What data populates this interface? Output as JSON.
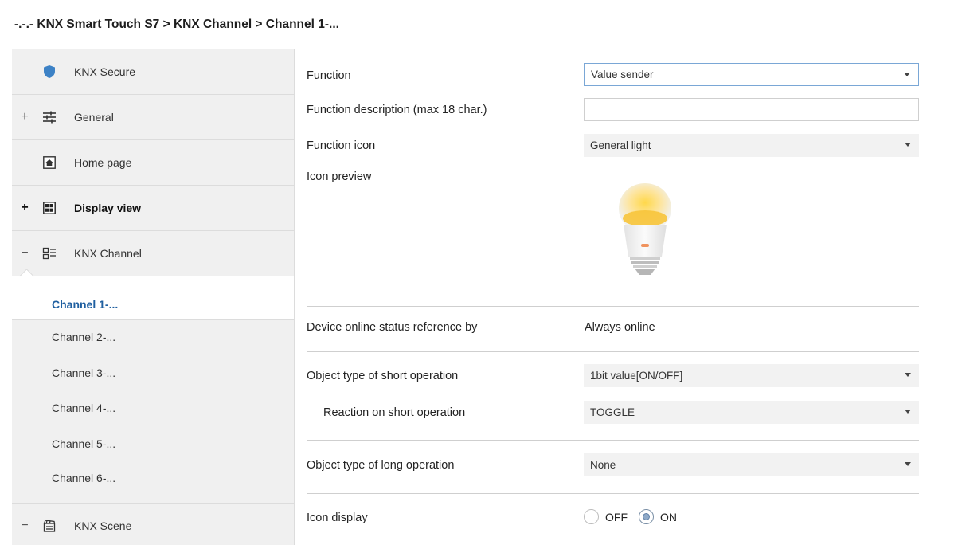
{
  "breadcrumb": "-.-.- KNX Smart Touch S7 > KNX Channel  > Channel 1-...",
  "sidebar": {
    "items": [
      {
        "label": "KNX Secure",
        "toggle": "",
        "icon": "shield-icon"
      },
      {
        "label": "General",
        "toggle": "+",
        "icon": "sliders-icon"
      },
      {
        "label": "Home page",
        "toggle": "",
        "icon": "home-icon"
      },
      {
        "label": "Display view",
        "toggle": "+",
        "icon": "grid-icon"
      },
      {
        "label": "KNX Channel",
        "toggle": "−",
        "icon": "channel-icon"
      }
    ],
    "channels": [
      "Channel 1-...",
      "Channel 2-...",
      "Channel 3-...",
      "Channel 4-...",
      "Channel 5-...",
      "Channel 6-..."
    ],
    "scene": {
      "label": "KNX Scene",
      "toggle": "−",
      "icon": "scene-icon"
    }
  },
  "form": {
    "function_label": "Function",
    "function_value": "Value sender",
    "description_label": "Function description (max 18 char.)",
    "description_value": "",
    "icon_label": "Function icon",
    "icon_value": "General light",
    "preview_label": "Icon preview",
    "online_label": "Device online status reference by",
    "online_value": "Always online",
    "short_type_label": "Object type of short operation",
    "short_type_value": "1bit value[ON/OFF]",
    "short_reaction_label": "Reaction on short operation",
    "short_reaction_value": "TOGGLE",
    "long_type_label": "Object type of long operation",
    "long_type_value": "None",
    "icon_display_label": "Icon display",
    "icon_display_options": [
      "OFF",
      "ON"
    ],
    "icon_display_selected": "ON"
  },
  "colors": {
    "accent": "#1f5fa0",
    "shield": "#3d82c6"
  }
}
